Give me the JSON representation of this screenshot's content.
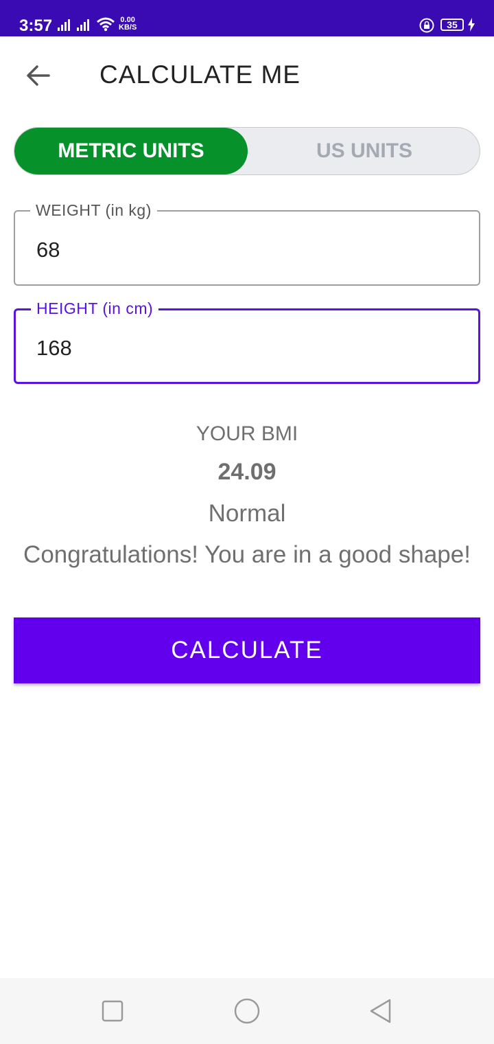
{
  "status_bar": {
    "time": "3:57",
    "speed_value": "0.00",
    "speed_unit": "KB/S",
    "battery": "35",
    "icons": [
      "signal-icon",
      "signal-icon",
      "wifi-icon",
      "rotation-lock-icon",
      "battery-icon",
      "charging-icon"
    ]
  },
  "header": {
    "title": "CALCULATE ME",
    "back_icon": "arrow-left-icon"
  },
  "units_toggle": {
    "metric_label": "METRIC UNITS",
    "us_label": "US UNITS",
    "selected": "METRIC UNITS"
  },
  "form": {
    "weight_label": "WEIGHT (in kg)",
    "weight_value": "68",
    "height_label": "HEIGHT (in cm)",
    "height_value": "168"
  },
  "result": {
    "title": "YOUR BMI",
    "value": "24.09",
    "category": "Normal",
    "message": "Congratulations! You are in a good shape!"
  },
  "actions": {
    "calculate_label": "CALCULATE"
  },
  "nav_bar": {
    "icons": [
      "recents-square-icon",
      "home-circle-icon",
      "back-triangle-icon"
    ]
  },
  "colors": {
    "status_bar": "#3a0ab2",
    "accent": "#6200ee",
    "metric_active": "#07912b",
    "toggle_inactive_bg": "#ebecef"
  }
}
